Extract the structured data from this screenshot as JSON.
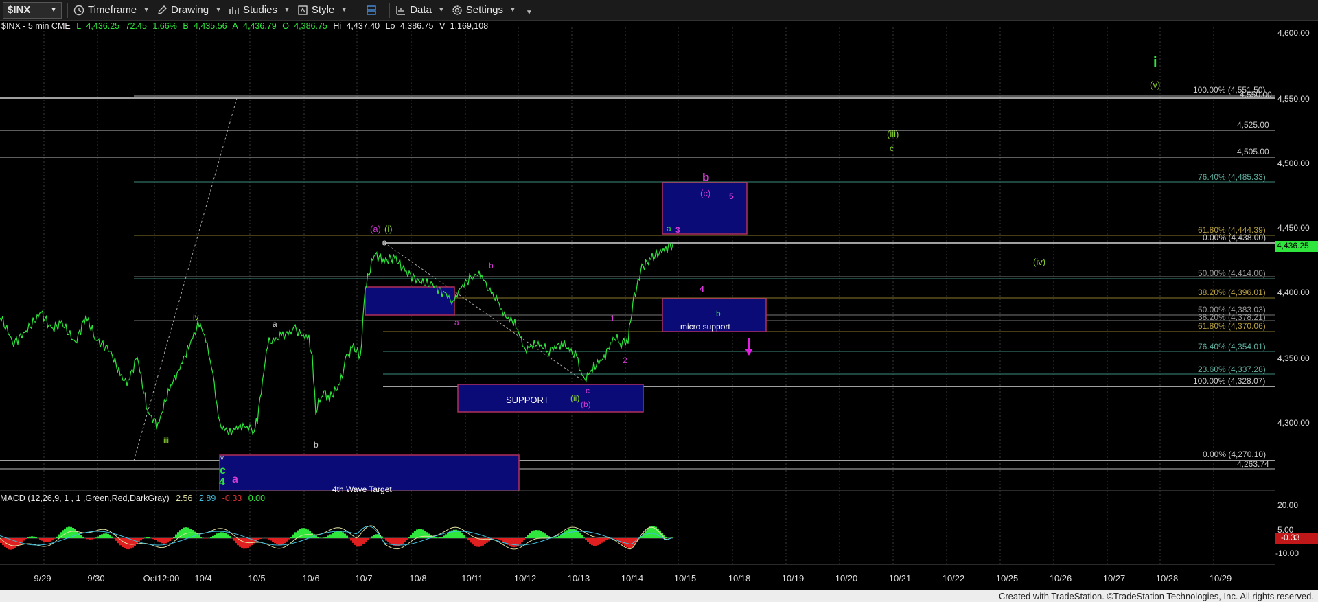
{
  "toolbar": {
    "symbol": "$INX",
    "timeframe": "Timeframe",
    "drawing": "Drawing",
    "studies": "Studies",
    "style": "Style",
    "data": "Data",
    "settings": "Settings"
  },
  "header": {
    "symbol_desc": "$INX - 5 min  CME",
    "last": "L=4,436.25",
    "change": "72.45",
    "pct": "1.66%",
    "bid": "B=4,435.56",
    "ask": "A=4,436.79",
    "open": "O=4,386.75",
    "high": "Hi=4,437.40",
    "low": "Lo=4,386.75",
    "volume": "V=1,169,108"
  },
  "price_axis": {
    "labels": [
      "4,600.00",
      "4,550.00",
      "4,500.00",
      "4,450.00",
      "4,400.00",
      "4,350.00",
      "4,300.00"
    ],
    "current_price": "4,436.25",
    "macd_labels": [
      "20.00",
      "5.00",
      "-10.00"
    ],
    "macd_current": "-0.33"
  },
  "fib_levels": {
    "l100a": "100.00% (4,551.50)",
    "l4550": "4,550.00",
    "l4525": "4,525.00",
    "l4505": "4,505.00",
    "l7640a": "76.40% (4,485.33)",
    "l6180a": "61.80% (4,444.39)",
    "l0a": "0.00% (4,438.00)",
    "l50a": "50.00% (4,414.00)",
    "l3820a": "38.20% (4,396.01)",
    "l50b": "50.00% (4,383.03)",
    "l3820b": "38.20% (4,378.21)",
    "l6180b": "61.80% (4,370.06)",
    "l7640b": "76.40% (4,354.01)",
    "l2360": "23.60% (4,337.28)",
    "l100b": "100.00% (4,328.07)",
    "l0b": "0.00% (4,270.10)",
    "l4263": "4,263.74"
  },
  "boxes": {
    "support": "SUPPORT",
    "micro_support": "micro support",
    "fourth_wave": "4th Wave Target"
  },
  "waves": {
    "i_big": "i",
    "v_paren": "(v)",
    "iii_paren": "(iii)",
    "c_green_top": "c",
    "iv_paren": "(iv)",
    "b_magenta": "b",
    "c_paren_mag": "(c)",
    "five_mag": "5",
    "a_green": "a",
    "three_mag": "3",
    "four_mag": "4",
    "b_green": "b",
    "a_paren_mag": "(a)",
    "i_paren_green": "(i)",
    "b_small_mag": "b",
    "a_small_mag": "a",
    "one_mag": "1",
    "two_mag": "2",
    "c_small_mag": "c",
    "ii_paren": "(ii)",
    "b_paren_mag": "(b)",
    "iv_small": "iv",
    "iii_small": "iii",
    "a_white": "a",
    "b_white": "b",
    "c_green_big": "c",
    "four_green": "4",
    "a_mag_big": "a",
    "v_small": "v"
  },
  "macd": {
    "label": "MACD (12,26,9, 1 , 1 ,Green,Red,DarkGray)",
    "v1": "2.56",
    "v2": "2.89",
    "v3": "-0.33",
    "v4": "0.00"
  },
  "dates": [
    "9/29",
    "9/30",
    "Oct12:00",
    "10/4",
    "10/5",
    "10/6",
    "10/7",
    "10/8",
    "10/11",
    "10/12",
    "10/13",
    "10/14",
    "10/15",
    "10/18",
    "10/19",
    "10/20",
    "10/21",
    "10/22",
    "10/25",
    "10/26",
    "10/27",
    "10/28",
    "10/29"
  ],
  "footer": "Created with TradeStation. ©TradeStation Technologies, Inc. All rights reserved.",
  "colors": {
    "price": "#2ee63c",
    "magenta": "#d43bd4",
    "wave_green": "#8ad432",
    "box_fill": "#0b0b78",
    "box_border": "#b0305a"
  }
}
